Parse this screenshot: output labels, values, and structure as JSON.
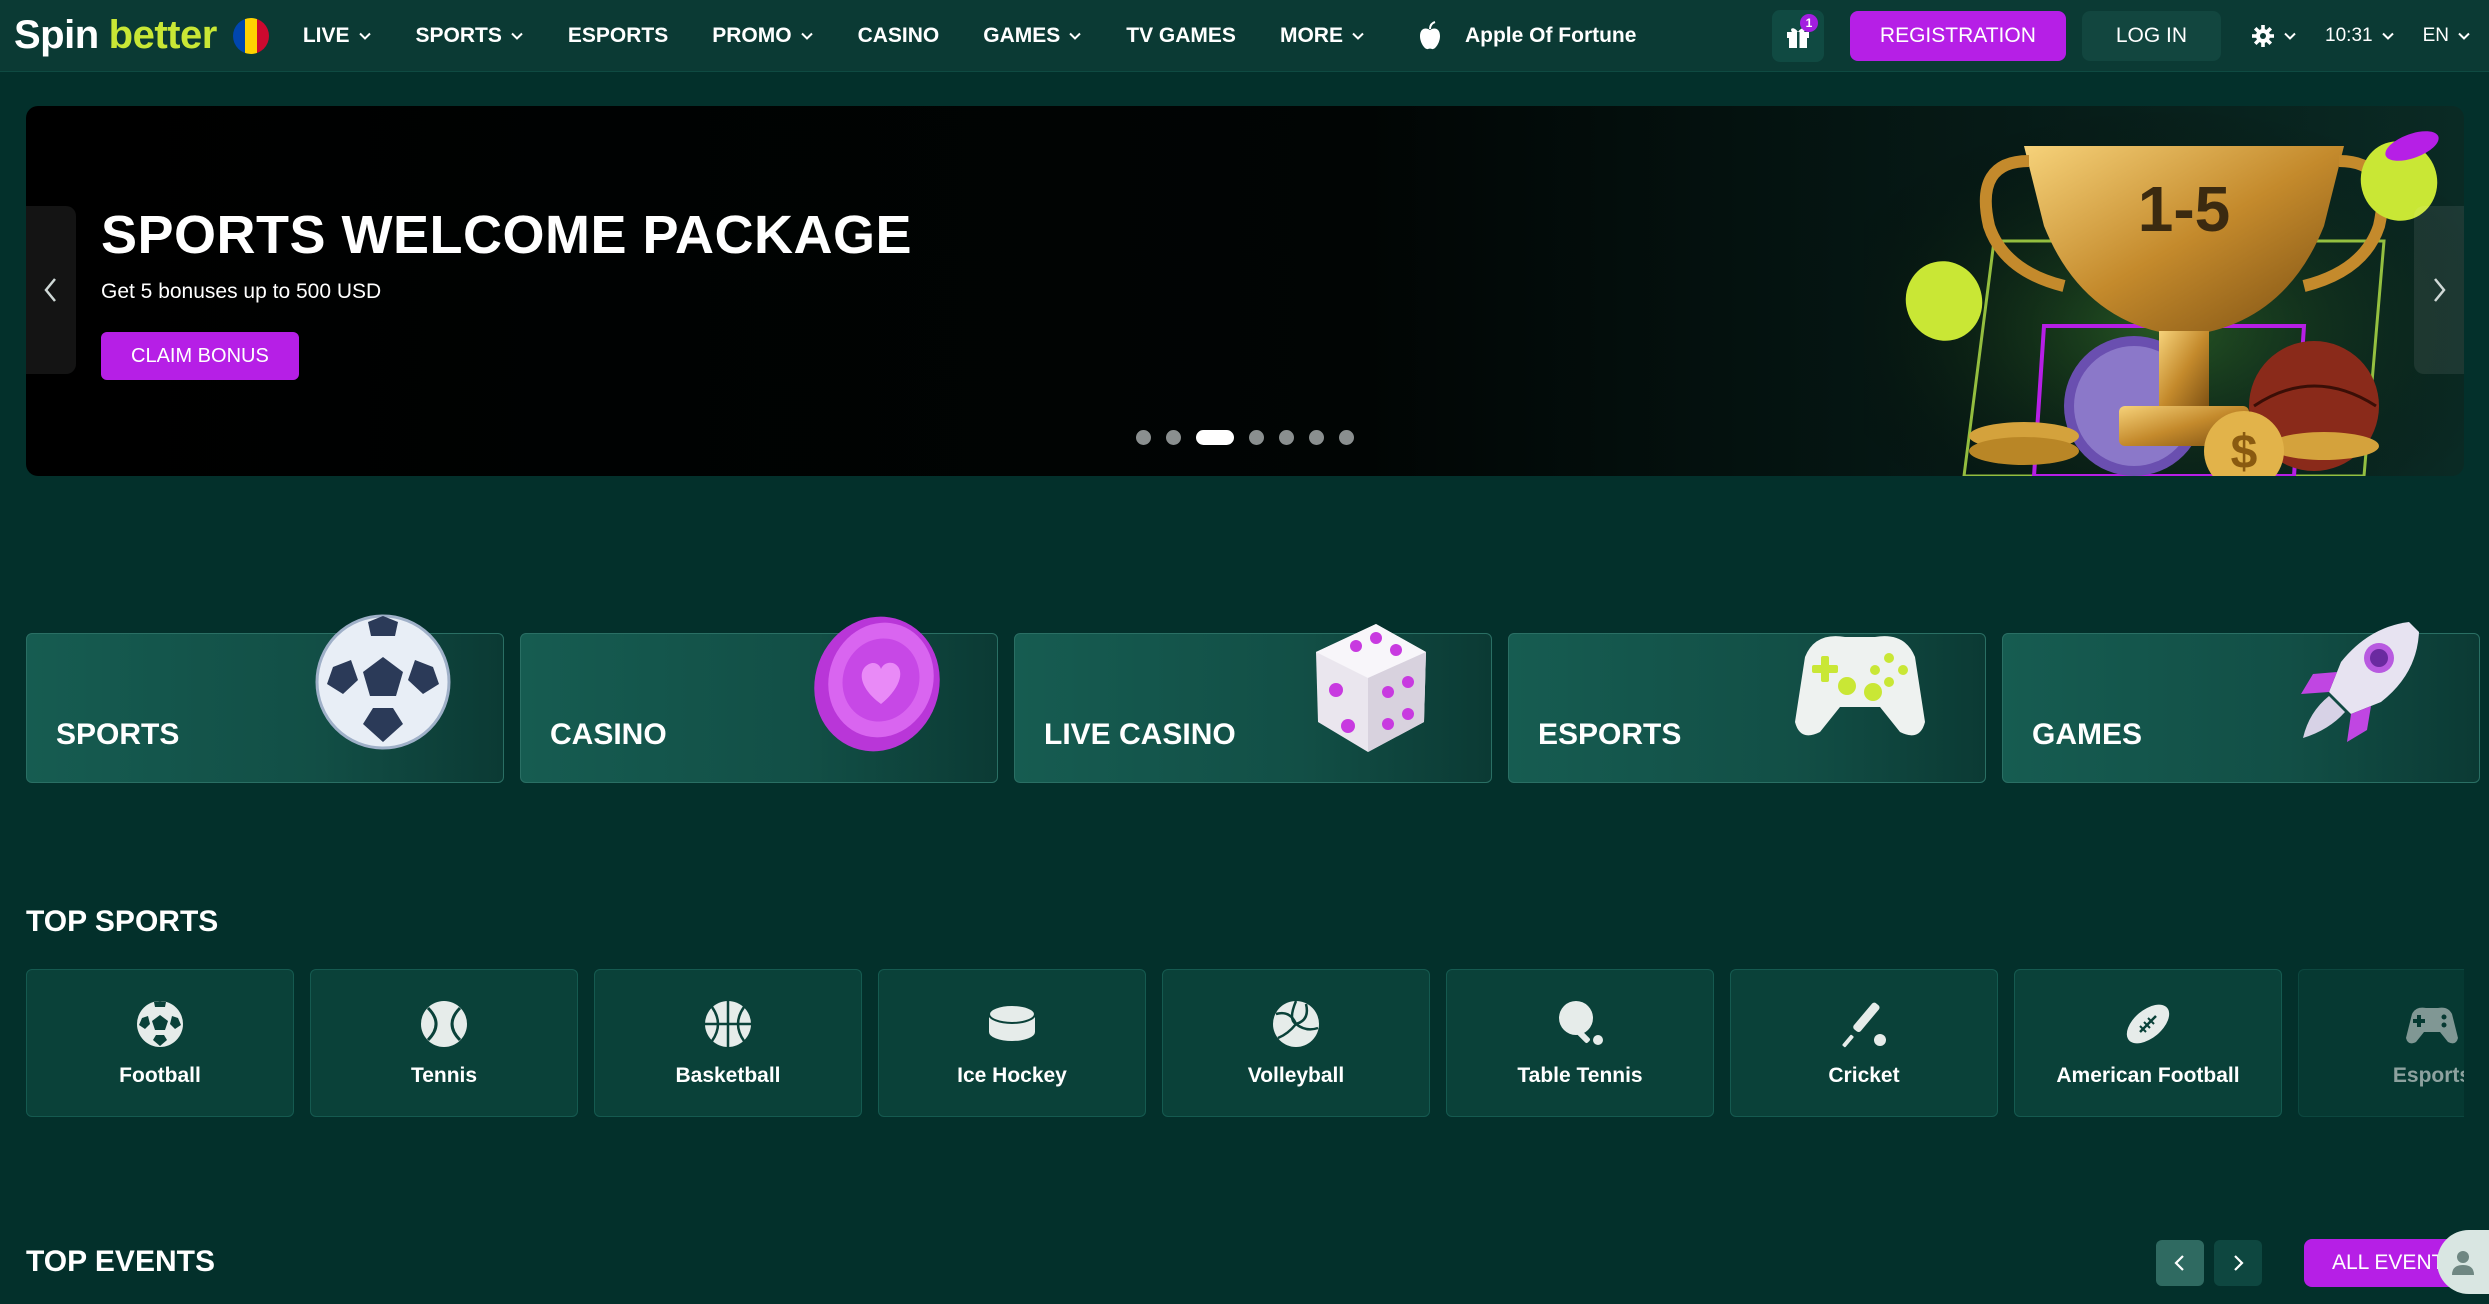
{
  "header": {
    "logo_spin": "Spin",
    "logo_better": "better",
    "nav": [
      {
        "label": "LIVE",
        "dropdown": true
      },
      {
        "label": "SPORTS",
        "dropdown": true
      },
      {
        "label": "ESPORTS",
        "dropdown": false
      },
      {
        "label": "PROMO",
        "dropdown": true
      },
      {
        "label": "CASINO",
        "dropdown": false
      },
      {
        "label": "GAMES",
        "dropdown": true
      },
      {
        "label": "TV GAMES",
        "dropdown": false
      },
      {
        "label": "MORE",
        "dropdown": true
      }
    ],
    "promo_game": "Apple Of Fortune",
    "gift_count": "1",
    "registration_label": "REGISTRATION",
    "login_label": "LOG IN",
    "time": "10:31",
    "language": "EN"
  },
  "banner": {
    "title": "SPORTS WELCOME PACKAGE",
    "subtitle": "Get 5 bonuses up to 500 USD",
    "cta": "CLAIM BONUS",
    "trophy_text": "1-5",
    "slide_count": 7,
    "active_slide": 3
  },
  "categories": [
    {
      "label": "SPORTS",
      "icon": "soccer-ball-icon"
    },
    {
      "label": "CASINO",
      "icon": "casino-chip-icon"
    },
    {
      "label": "LIVE CASINO",
      "icon": "dice-icon"
    },
    {
      "label": "ESPORTS",
      "icon": "gamepad-icon"
    },
    {
      "label": "GAMES",
      "icon": "rocket-icon"
    }
  ],
  "top_sports": {
    "title": "TOP SPORTS",
    "items": [
      {
        "label": "Football",
        "icon": "football-icon"
      },
      {
        "label": "Tennis",
        "icon": "tennis-icon"
      },
      {
        "label": "Basketball",
        "icon": "basketball-icon"
      },
      {
        "label": "Ice Hockey",
        "icon": "ice-hockey-icon"
      },
      {
        "label": "Volleyball",
        "icon": "volleyball-icon"
      },
      {
        "label": "Table Tennis",
        "icon": "table-tennis-icon"
      },
      {
        "label": "Cricket",
        "icon": "cricket-icon"
      },
      {
        "label": "American Football",
        "icon": "american-football-icon"
      },
      {
        "label": "Esports",
        "icon": "esports-icon"
      }
    ]
  },
  "top_events": {
    "title": "TOP EVENTS",
    "all_label": "ALL EVENTS"
  },
  "colors": {
    "background": "#03302b",
    "header": "#0b3a34",
    "accent": "#b61fe6",
    "logo_green": "#c9e735"
  }
}
